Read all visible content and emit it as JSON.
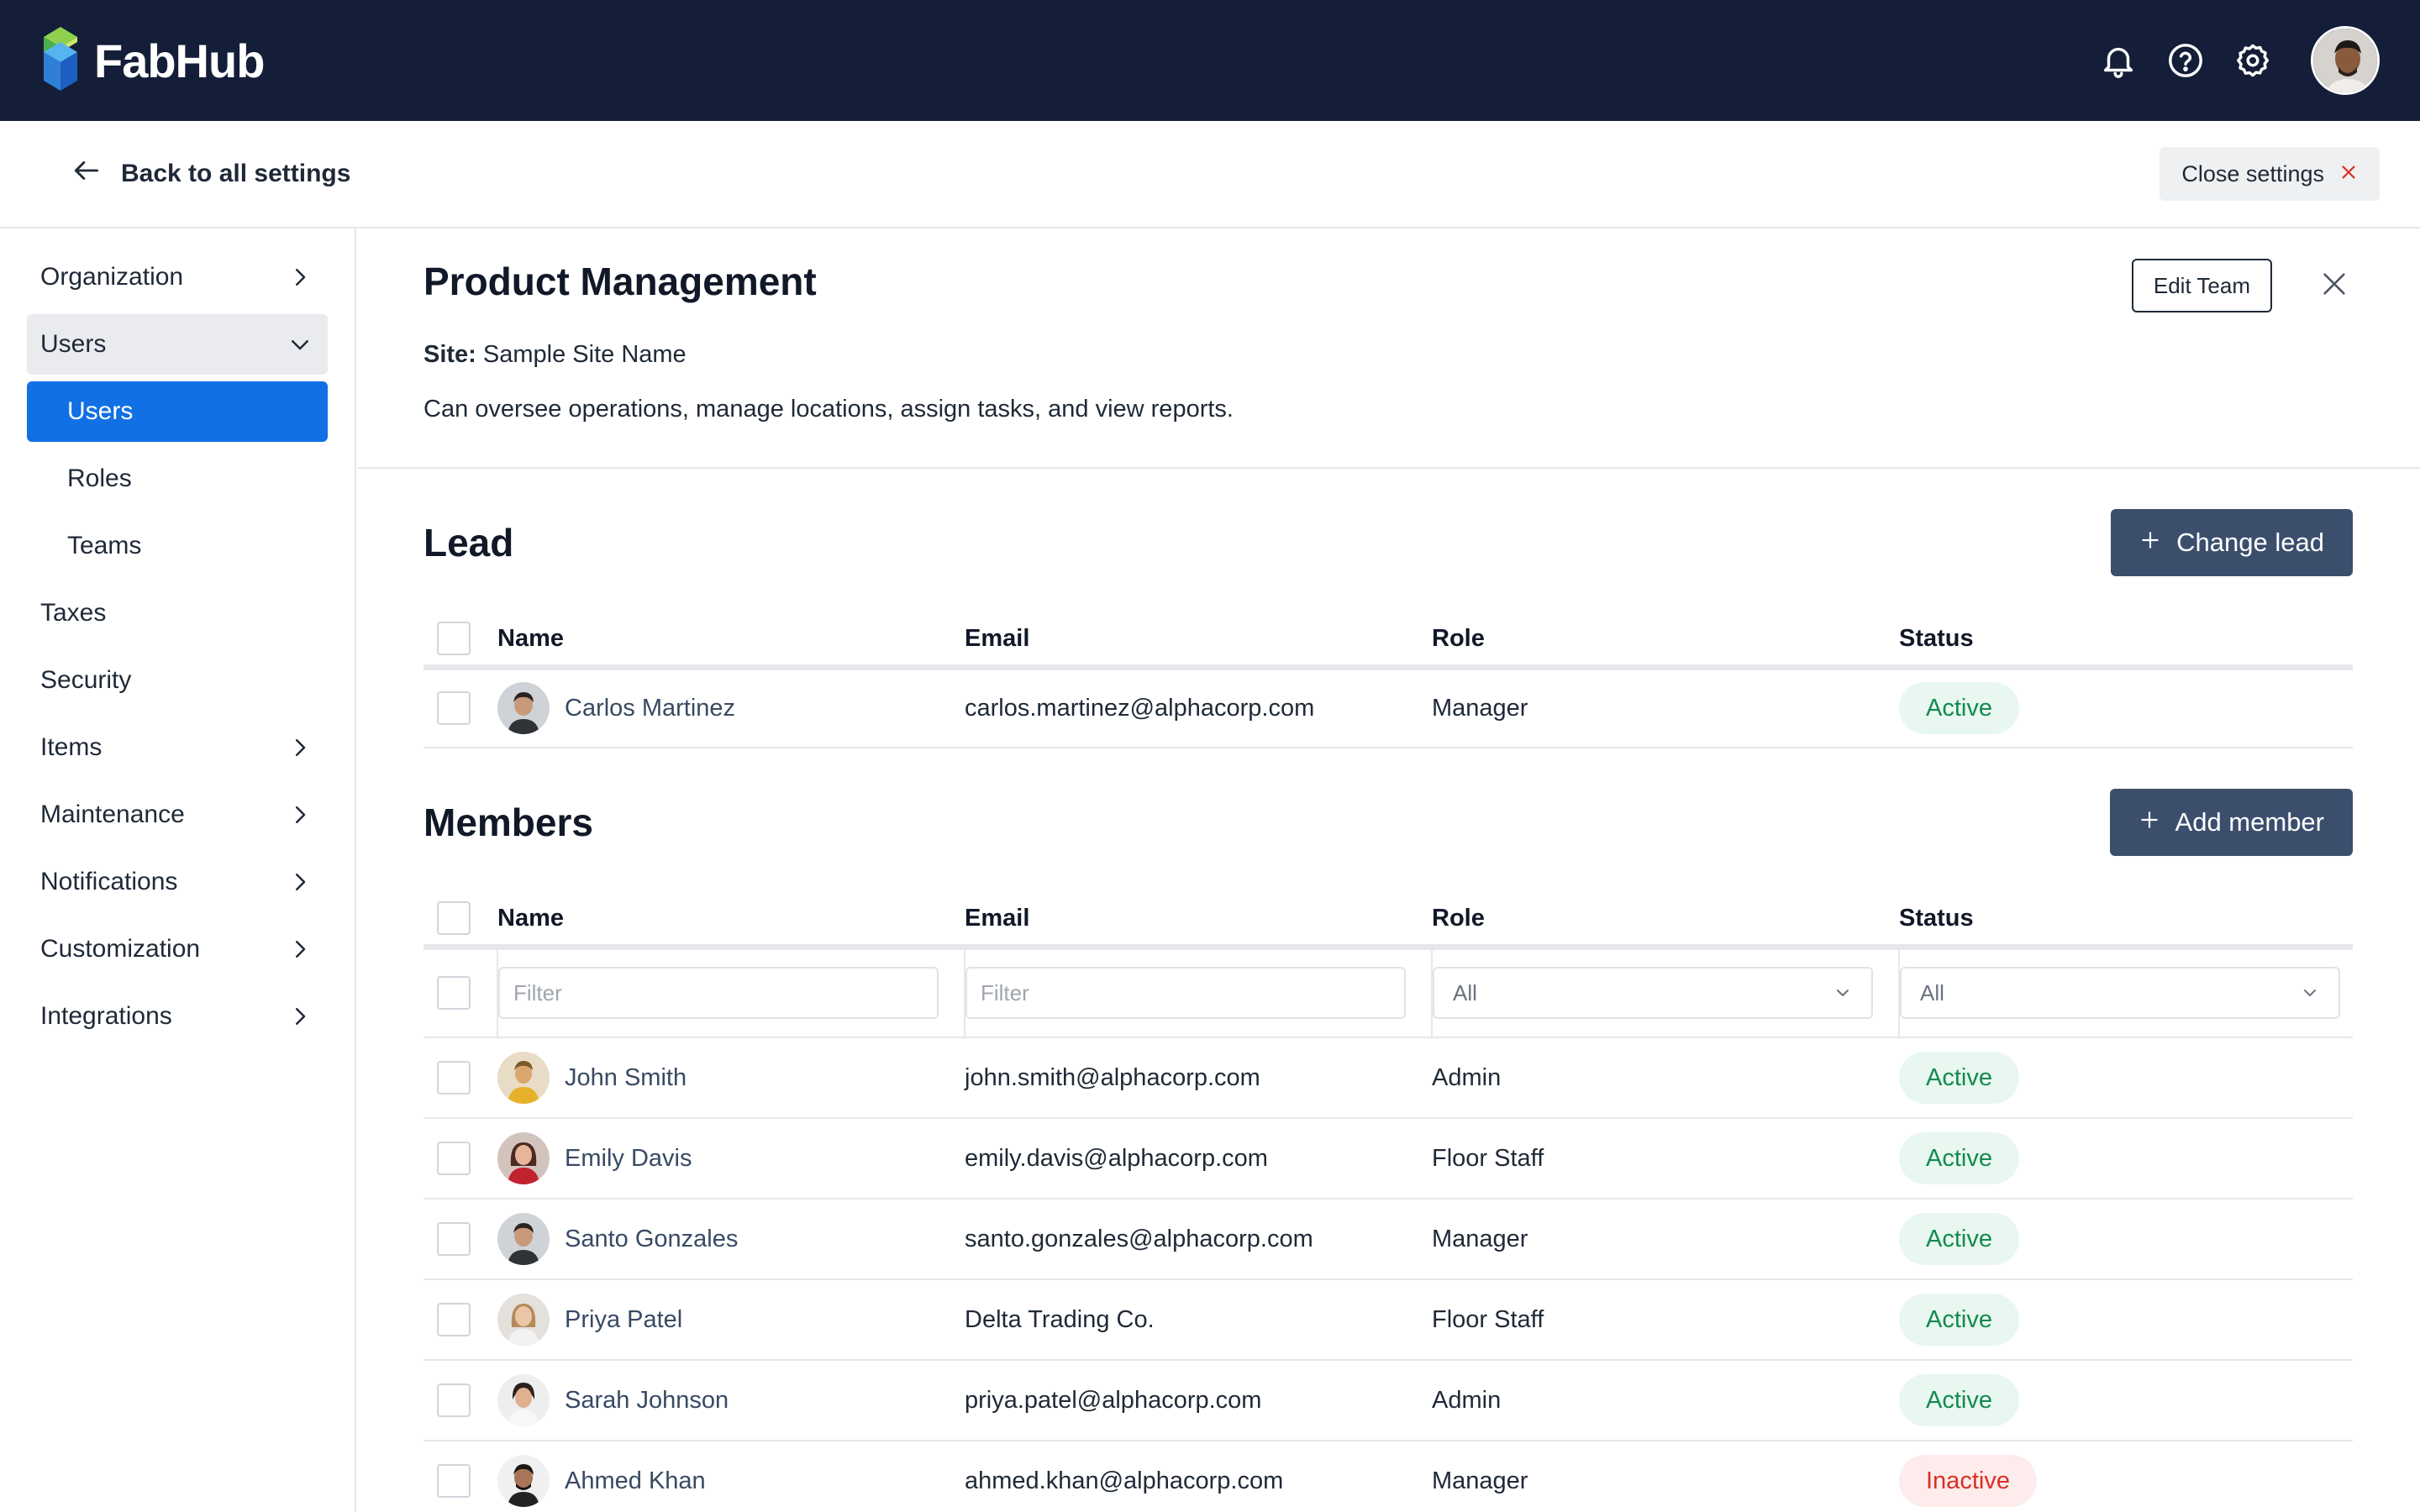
{
  "brand": {
    "name": "FabHub"
  },
  "header": {
    "back_label": "Back to all settings",
    "close_settings_label": "Close settings"
  },
  "sidebar": {
    "items": [
      {
        "label": "Organization",
        "chevron": "right"
      },
      {
        "label": "Users",
        "chevron": "down"
      },
      {
        "label": "Users"
      },
      {
        "label": "Roles"
      },
      {
        "label": "Teams"
      },
      {
        "label": "Taxes"
      },
      {
        "label": "Security"
      },
      {
        "label": "Items",
        "chevron": "right"
      },
      {
        "label": "Maintenance",
        "chevron": "right"
      },
      {
        "label": "Notifications",
        "chevron": "right"
      },
      {
        "label": "Customization",
        "chevron": "right"
      },
      {
        "label": "Integrations",
        "chevron": "right"
      }
    ]
  },
  "team": {
    "title": "Product Management",
    "edit_label": "Edit Team",
    "site_label": "Site:",
    "site_value": "Sample Site Name",
    "description": "Can oversee operations, manage locations, assign tasks, and view reports."
  },
  "lead": {
    "title": "Lead",
    "button_label": "Change lead",
    "columns": [
      "Name",
      "Email",
      "Role",
      "Status"
    ],
    "row": {
      "name": "Carlos Martinez",
      "email": "carlos.martinez@alphacorp.com",
      "role": "Manager",
      "status": "Active"
    }
  },
  "members": {
    "title": "Members",
    "button_label": "Add member",
    "columns": [
      "Name",
      "Email",
      "Role",
      "Status"
    ],
    "filters": {
      "name_placeholder": "Filter",
      "email_placeholder": "Filter",
      "role_value": "All",
      "status_value": "All"
    },
    "rows": [
      {
        "name": "John Smith",
        "email": "john.smith@alphacorp.com",
        "role": "Admin",
        "status": "Active"
      },
      {
        "name": "Emily Davis",
        "email": "emily.davis@alphacorp.com",
        "role": "Floor Staff",
        "status": "Active"
      },
      {
        "name": "Santo Gonzales",
        "email": "santo.gonzales@alphacorp.com",
        "role": "Manager",
        "status": "Active"
      },
      {
        "name": "Priya Patel",
        "email": "Delta Trading Co.",
        "role": "Floor Staff",
        "status": "Active"
      },
      {
        "name": "Sarah Johnson",
        "email": "priya.patel@alphacorp.com",
        "role": "Admin",
        "status": "Active"
      },
      {
        "name": "Ahmed Khan",
        "email": "ahmed.khan@alphacorp.com",
        "role": "Manager",
        "status": "Inactive"
      }
    ]
  },
  "colors": {
    "topbar": "#141e38",
    "accent": "#1170e4",
    "primary_button": "#3b4f6d",
    "active_text": "#138a4f",
    "inactive_text": "#d93025"
  }
}
